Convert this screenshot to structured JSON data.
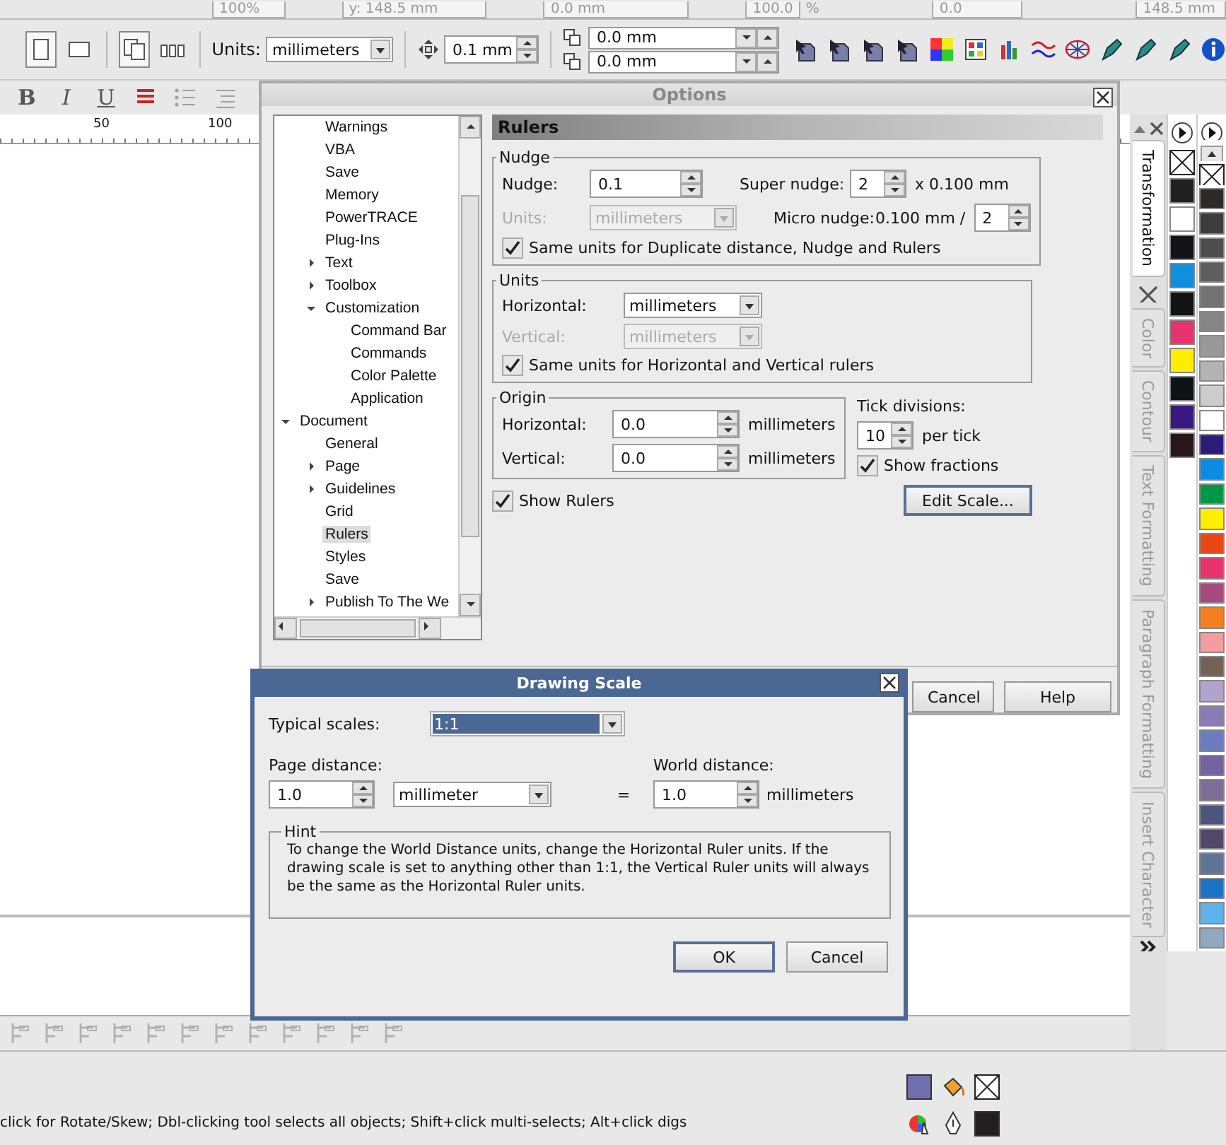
{
  "toolbar_top": {
    "zoom": "100%",
    "y_position": "y: 148.5 mm",
    "height": "0.0 mm",
    "scale": "100.0",
    "percent": "%",
    "angle": "0.0",
    "field_6": "148.5 mm"
  },
  "property_bar": {
    "orientation": [
      {
        "selected": true
      },
      {
        "selected": false
      }
    ],
    "page_layout": [
      {
        "selected": true
      },
      {
        "selected": false
      }
    ],
    "units_label": "Units:",
    "units": "millimeters",
    "nudge": "0.1 mm",
    "duplicate_x": "0.0 mm",
    "duplicate_y": "0.0 mm"
  },
  "text_bar": {
    "bold": "B",
    "italic": "I",
    "underline": "U"
  },
  "ruler": {
    "ticks": [
      "50",
      "100"
    ]
  },
  "options": {
    "title": "Options",
    "tree": [
      {
        "children": [
          {
            "label": "Warnings",
            "selected": false
          },
          {
            "label": "VBA",
            "selected": false
          },
          {
            "label": "Save",
            "selected": false
          },
          {
            "label": "Memory",
            "selected": false
          },
          {
            "label": "PowerTRACE",
            "selected": false
          },
          {
            "label": "Plug-Ins",
            "selected": false
          },
          {
            "label": "Text",
            "expanded": false,
            "selected": false
          },
          {
            "label": "Toolbox",
            "expanded": false,
            "selected": false
          },
          {
            "label": "Customization",
            "expanded": true,
            "selected": false,
            "children": [
              {
                "label": "Command Bar",
                "selected": false
              },
              {
                "label": "Commands",
                "selected": false
              },
              {
                "label": "Color Palette",
                "selected": false
              },
              {
                "label": "Application",
                "selected": false
              }
            ]
          }
        ]
      },
      {
        "label": "Document",
        "expanded": true,
        "selected": false,
        "children": [
          {
            "label": "General",
            "selected": false
          },
          {
            "label": "Page",
            "expanded": false,
            "selected": false
          },
          {
            "label": "Guidelines",
            "expanded": false,
            "selected": false
          },
          {
            "label": "Grid",
            "selected": false
          },
          {
            "label": "Rulers",
            "selected": true
          },
          {
            "label": "Styles",
            "selected": false
          },
          {
            "label": "Save",
            "selected": false
          },
          {
            "label": "Publish To The We",
            "expanded": false,
            "selected": false
          }
        ]
      }
    ],
    "page_title": "Rulers",
    "nudge_group": {
      "title": "Nudge",
      "nudge_label": "Nudge:",
      "nudge": "0.1",
      "units_label": "Units:",
      "units": "millimeters",
      "units_disabled": true,
      "super_label": "Super nudge:",
      "super": "2",
      "super_suffix": "x 0.100 mm",
      "micro_label": "Micro nudge:",
      "micro_prefix": "0.100 mm /",
      "micro": "2",
      "same_units": {
        "label": "Same units for Duplicate distance, Nudge and Rulers",
        "checked": true
      }
    },
    "units_group": {
      "title": "Units",
      "horizontal_label": "Horizontal:",
      "horizontal": "millimeters",
      "vertical_label": "Vertical:",
      "vertical": "millimeters",
      "vertical_disabled": true,
      "same_units": {
        "label": "Same units for Horizontal and Vertical rulers",
        "checked": true
      }
    },
    "origin_group": {
      "title": "Origin",
      "horizontal_label": "Horizontal:",
      "horizontal": "0.0",
      "horizontal_unit": "millimeters",
      "vertical_label": "Vertical:",
      "vertical": "0.0",
      "vertical_unit": "millimeters"
    },
    "tick_divisions": {
      "label": "Tick divisions:",
      "value": "10",
      "suffix": "per tick",
      "show_fractions": {
        "label": "Show fractions",
        "checked": true
      }
    },
    "show_rulers": {
      "label": "Show Rulers",
      "checked": true
    },
    "edit_scale": "Edit Scale...",
    "buttons": [
      "Cancel",
      "Help"
    ]
  },
  "drawing_scale": {
    "title": "Drawing Scale",
    "typical_label": "Typical scales:",
    "typical": "1:1",
    "page_label": "Page distance:",
    "page_value": "1.0",
    "page_unit": "millimeter",
    "equals": "=",
    "world_label": "World distance:",
    "world_value": "1.0",
    "world_unit": "millimeters",
    "hint_title": "Hint",
    "hint": "To change the World Distance units, change the Horizontal Ruler units.  If the drawing scale is set to anything other than 1:1, the Vertical Ruler units will always be the same as the Horizontal Ruler units.",
    "buttons": [
      "OK",
      "Cancel"
    ]
  },
  "dockers": [
    {
      "label": "Transformation",
      "selected": true
    },
    {
      "label": "Color",
      "selected": false
    },
    {
      "label": "Contour",
      "selected": false
    },
    {
      "label": "Text Formatting",
      "selected": false
    },
    {
      "label": "Paragraph Formatting",
      "selected": false
    },
    {
      "label": "Insert Character",
      "selected": false
    }
  ],
  "palettes": [
    {
      "colors": [
        {
          "kind": "none"
        },
        {
          "kind": "swatch",
          "color": "#231f20"
        },
        {
          "kind": "swatch",
          "color": "#ffffff"
        },
        {
          "kind": "swatch",
          "color": "#14131a"
        },
        {
          "kind": "swatch",
          "color": "#0f8fdd"
        },
        {
          "kind": "swatch",
          "color": "#131416"
        },
        {
          "kind": "swatch",
          "color": "#e8336f"
        },
        {
          "kind": "swatch",
          "color": "#ffee00"
        },
        {
          "kind": "swatch",
          "color": "#0e1318"
        },
        {
          "kind": "swatch",
          "color": "#3a1780"
        },
        {
          "kind": "swatch",
          "color": "#2a1618"
        }
      ]
    },
    {
      "colors": [
        {
          "kind": "none"
        },
        {
          "kind": "swatch",
          "color": "#2b2a29"
        },
        {
          "kind": "swatch",
          "color": "#3d3c3c"
        },
        {
          "kind": "swatch",
          "color": "#4d4d4d"
        },
        {
          "kind": "swatch",
          "color": "#5e5e5e"
        },
        {
          "kind": "swatch",
          "color": "#727272"
        },
        {
          "kind": "swatch",
          "color": "#858585"
        },
        {
          "kind": "swatch",
          "color": "#999999"
        },
        {
          "kind": "swatch",
          "color": "#b3b3b3"
        },
        {
          "kind": "swatch",
          "color": "#cccccc"
        },
        {
          "kind": "swatch",
          "color": "#ffffff"
        },
        {
          "kind": "swatch",
          "color": "#2e1a78"
        },
        {
          "kind": "swatch",
          "color": "#0c8ce0"
        },
        {
          "kind": "swatch",
          "color": "#009846"
        },
        {
          "kind": "swatch",
          "color": "#ffee00"
        },
        {
          "kind": "swatch",
          "color": "#e94614"
        },
        {
          "kind": "swatch",
          "color": "#e8336f"
        },
        {
          "kind": "swatch",
          "color": "#a74a7f"
        },
        {
          "kind": "swatch",
          "color": "#f47f1f"
        },
        {
          "kind": "swatch",
          "color": "#f49da0"
        },
        {
          "kind": "swatch",
          "color": "#736357"
        },
        {
          "kind": "swatch",
          "color": "#b1a3cc"
        },
        {
          "kind": "swatch",
          "color": "#8a7bb6"
        },
        {
          "kind": "swatch",
          "color": "#6b7bbd"
        },
        {
          "kind": "swatch",
          "color": "#7661a1"
        },
        {
          "kind": "swatch",
          "color": "#7d6e98"
        },
        {
          "kind": "swatch",
          "color": "#4c5580"
        },
        {
          "kind": "swatch",
          "color": "#52486c"
        },
        {
          "kind": "swatch",
          "color": "#5f7394"
        },
        {
          "kind": "swatch",
          "color": "#1a73c4"
        },
        {
          "kind": "swatch",
          "color": "#5fb3e8"
        },
        {
          "kind": "swatch",
          "color": "#90a9bf"
        }
      ]
    }
  ],
  "status_bar": {
    "hint": "click for Rotate/Skew; Dbl-clicking tool selects all objects; Shift+click multi-selects; Alt+click digs"
  }
}
